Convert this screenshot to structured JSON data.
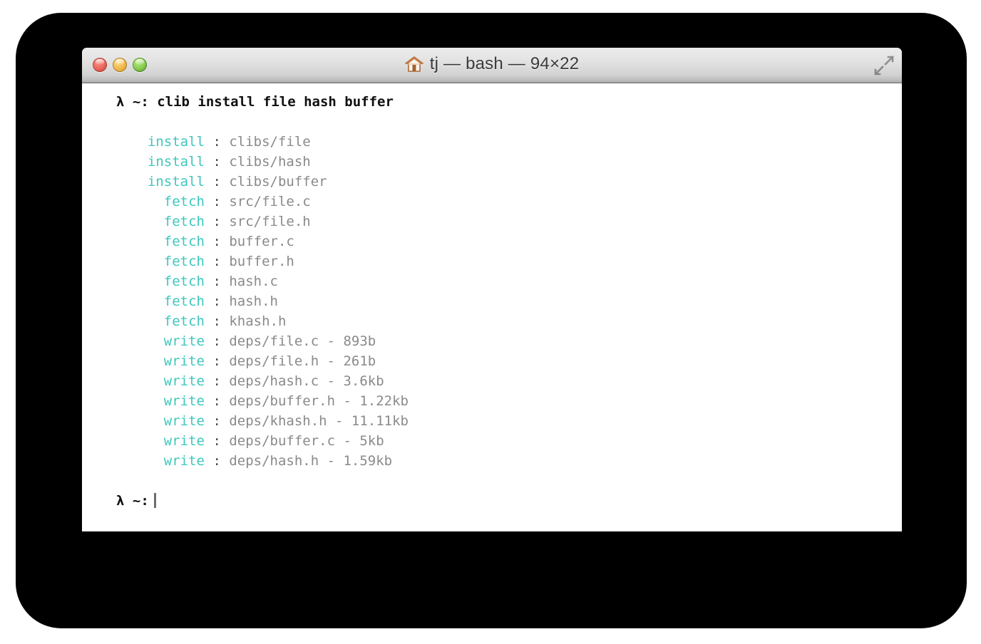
{
  "window": {
    "title": "tj — bash — 94×22",
    "icon": "house-icon",
    "controls": {
      "close_label": "",
      "minimize_label": "",
      "maximize_label": "",
      "fullscreen_label": ""
    }
  },
  "colors": {
    "keyword": "#3fc7bd",
    "value": "#8a8a8a",
    "prompt": "#111111",
    "close": "#ec6a5e",
    "minimize": "#f2bb50",
    "maximize": "#8ace54",
    "terminal_bg": "#ffffff",
    "frame": "#000000"
  },
  "terminal": {
    "prompt_symbol": "λ ~:",
    "command_line": "λ ~: clib install file hash buffer",
    "final_prompt": "λ ~:",
    "lines": [
      {
        "keyword": "install",
        "sep": ":",
        "value": "clibs/file"
      },
      {
        "keyword": "install",
        "sep": ":",
        "value": "clibs/hash"
      },
      {
        "keyword": "install",
        "sep": ":",
        "value": "clibs/buffer"
      },
      {
        "keyword": "fetch",
        "sep": ":",
        "value": "src/file.c"
      },
      {
        "keyword": "fetch",
        "sep": ":",
        "value": "src/file.h"
      },
      {
        "keyword": "fetch",
        "sep": ":",
        "value": "buffer.c"
      },
      {
        "keyword": "fetch",
        "sep": ":",
        "value": "buffer.h"
      },
      {
        "keyword": "fetch",
        "sep": ":",
        "value": "hash.c"
      },
      {
        "keyword": "fetch",
        "sep": ":",
        "value": "hash.h"
      },
      {
        "keyword": "fetch",
        "sep": ":",
        "value": "khash.h"
      },
      {
        "keyword": "write",
        "sep": ":",
        "value": "deps/file.c - 893b"
      },
      {
        "keyword": "write",
        "sep": ":",
        "value": "deps/file.h - 261b"
      },
      {
        "keyword": "write",
        "sep": ":",
        "value": "deps/hash.c - 3.6kb"
      },
      {
        "keyword": "write",
        "sep": ":",
        "value": "deps/buffer.h - 1.22kb"
      },
      {
        "keyword": "write",
        "sep": ":",
        "value": "deps/khash.h - 11.11kb"
      },
      {
        "keyword": "write",
        "sep": ":",
        "value": "deps/buffer.c - 5kb"
      },
      {
        "keyword": "write",
        "sep": ":",
        "value": "deps/hash.h - 1.59kb"
      }
    ]
  }
}
